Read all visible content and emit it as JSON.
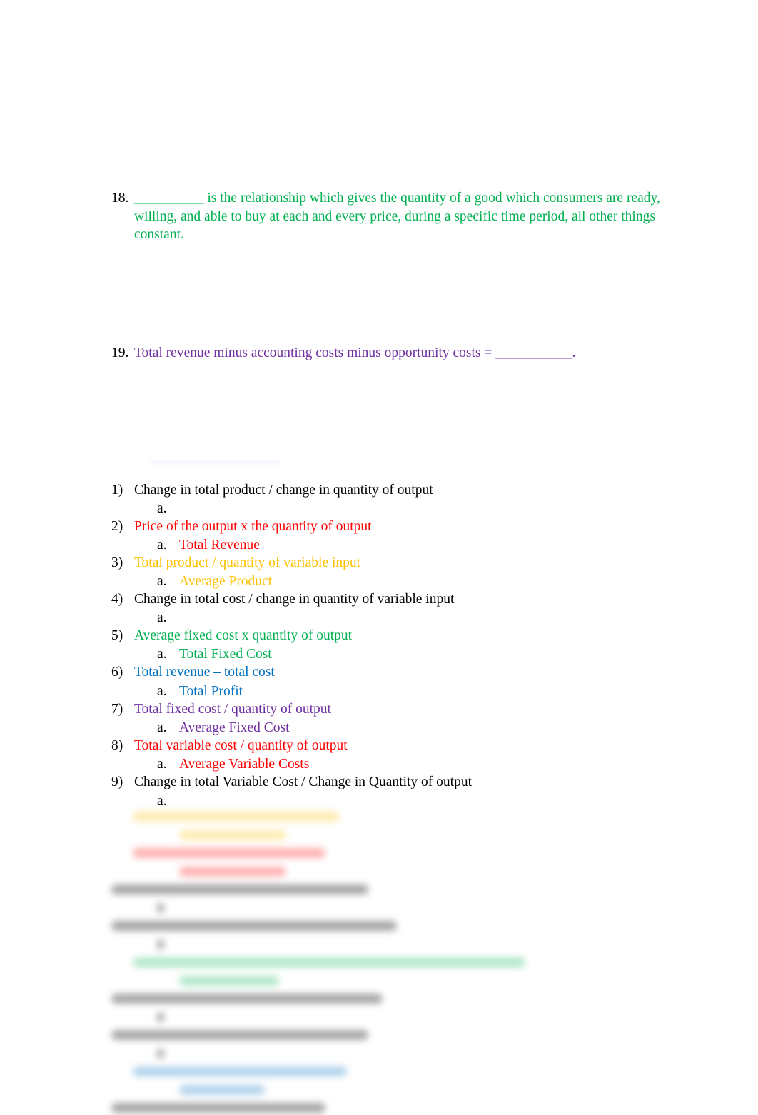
{
  "questions": [
    {
      "number": "18.",
      "text": "__________ is the relationship which gives the quantity of a good which consumers are ready, willing, and able to buy at each and every price, during a specific time period, all other things constant.",
      "color": "#00b050"
    },
    {
      "number": "19.",
      "text": "Total revenue minus accounting costs minus opportunity costs = ___________.",
      "color": "#7030a0"
    }
  ],
  "definitions": [
    {
      "number": "1)",
      "text": "Change in total product / change in quantity of output",
      "answer_letter": "a.",
      "answer": "",
      "color": "#000000"
    },
    {
      "number": "2)",
      "text": "Price of the output x the quantity of output",
      "answer_letter": "a.",
      "answer": "Total Revenue",
      "color": "#ff0000"
    },
    {
      "number": "3)",
      "text": "Total product / quantity of variable input",
      "answer_letter": "a.",
      "answer": "Average Product",
      "color": "#ffc000"
    },
    {
      "number": "4)",
      "text": "Change in total cost / change in quantity of variable input",
      "answer_letter": "a.",
      "answer": "",
      "color": "#000000"
    },
    {
      "number": "5)",
      "text": "Average fixed cost x quantity of output",
      "answer_letter": "a.",
      "answer": "Total Fixed Cost",
      "color": "#00b050"
    },
    {
      "number": "6)",
      "text": "Total revenue – total cost",
      "answer_letter": "a.",
      "answer": "Total Profit",
      "color": "#0070c0"
    },
    {
      "number": "7)",
      "text": "Total fixed cost / quantity of output",
      "answer_letter": "a.",
      "answer": "Average Fixed Cost",
      "color": "#7030a0"
    },
    {
      "number": "8)",
      "text": "Total variable cost / quantity of output",
      "answer_letter": "a.",
      "answer": "Average Variable Costs",
      "color": "#ff0000"
    },
    {
      "number": "9)",
      "text": "Change in total Variable Cost / Change in Quantity of output",
      "answer_letter": "a.",
      "answer": "",
      "color": "#000000"
    }
  ],
  "blurred_section": {
    "note": "content obscured",
    "row_colors": [
      "#ffc000",
      "#ffc000",
      "#ff0000",
      "#ff0000",
      "#000000",
      "#000000",
      "#000000",
      "#000000",
      "#00b050",
      "#00b050",
      "#000000",
      "#000000",
      "#000000",
      "#000000",
      "#0070c0",
      "#0070c0",
      "#000000"
    ]
  }
}
